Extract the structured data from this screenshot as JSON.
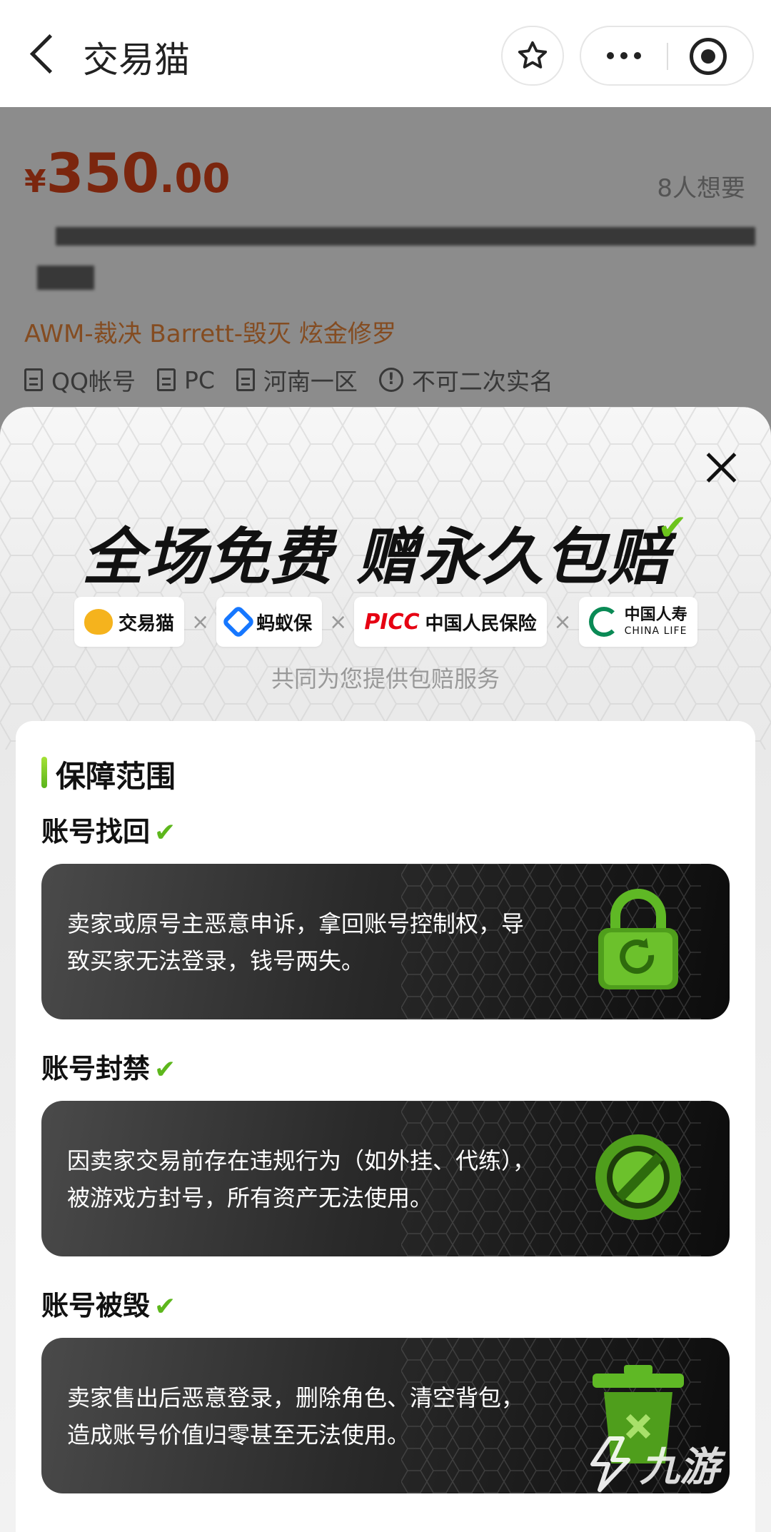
{
  "topbar": {
    "title": "交易猫"
  },
  "product": {
    "price_symbol": "¥",
    "price_int": "350",
    "price_dec": ".00",
    "want_count": "8人想要",
    "tags": "AWM-裁决 Barrett-毁灭 炫金修罗",
    "attributes": [
      "QQ帐号",
      "PC",
      "河南一区",
      "不可二次实名"
    ]
  },
  "sheet": {
    "headline": "全场免费 赠永久包赔",
    "partners": [
      {
        "name": "交易猫",
        "icon": "cat-logo-icon"
      },
      {
        "name": "蚂蚁保",
        "icon": "ant-logo-icon"
      },
      {
        "name": "中国人民保险",
        "prefix": "PICC",
        "icon": "picc-logo-icon"
      },
      {
        "name": "中国人寿",
        "sub": "CHINA LIFE",
        "icon": "china-life-logo-icon"
      }
    ],
    "partner_separator": "×",
    "subtitle": "共同为您提供包赔服务",
    "section_title": "保障范围",
    "items": [
      {
        "title": "账号找回",
        "desc": "卖家或原号主恶意申诉，拿回账号控制权，导致买家无法登录，钱号两失。",
        "icon": "padlock-refresh-icon"
      },
      {
        "title": "账号封禁",
        "desc": "因卖家交易前存在违规行为（如外挂、代练），被游戏方封号，所有资产无法使用。",
        "icon": "ban-icon"
      },
      {
        "title": "账号被毁",
        "desc": "卖家售出后恶意登录，删除角色、清空背包，造成账号价值归零甚至无法使用。",
        "icon": "trash-icon"
      }
    ]
  },
  "watermark": "九游",
  "colors": {
    "price": "#e0461a",
    "accent_green": "#5db71c",
    "tag_orange": "#f08a3c"
  }
}
